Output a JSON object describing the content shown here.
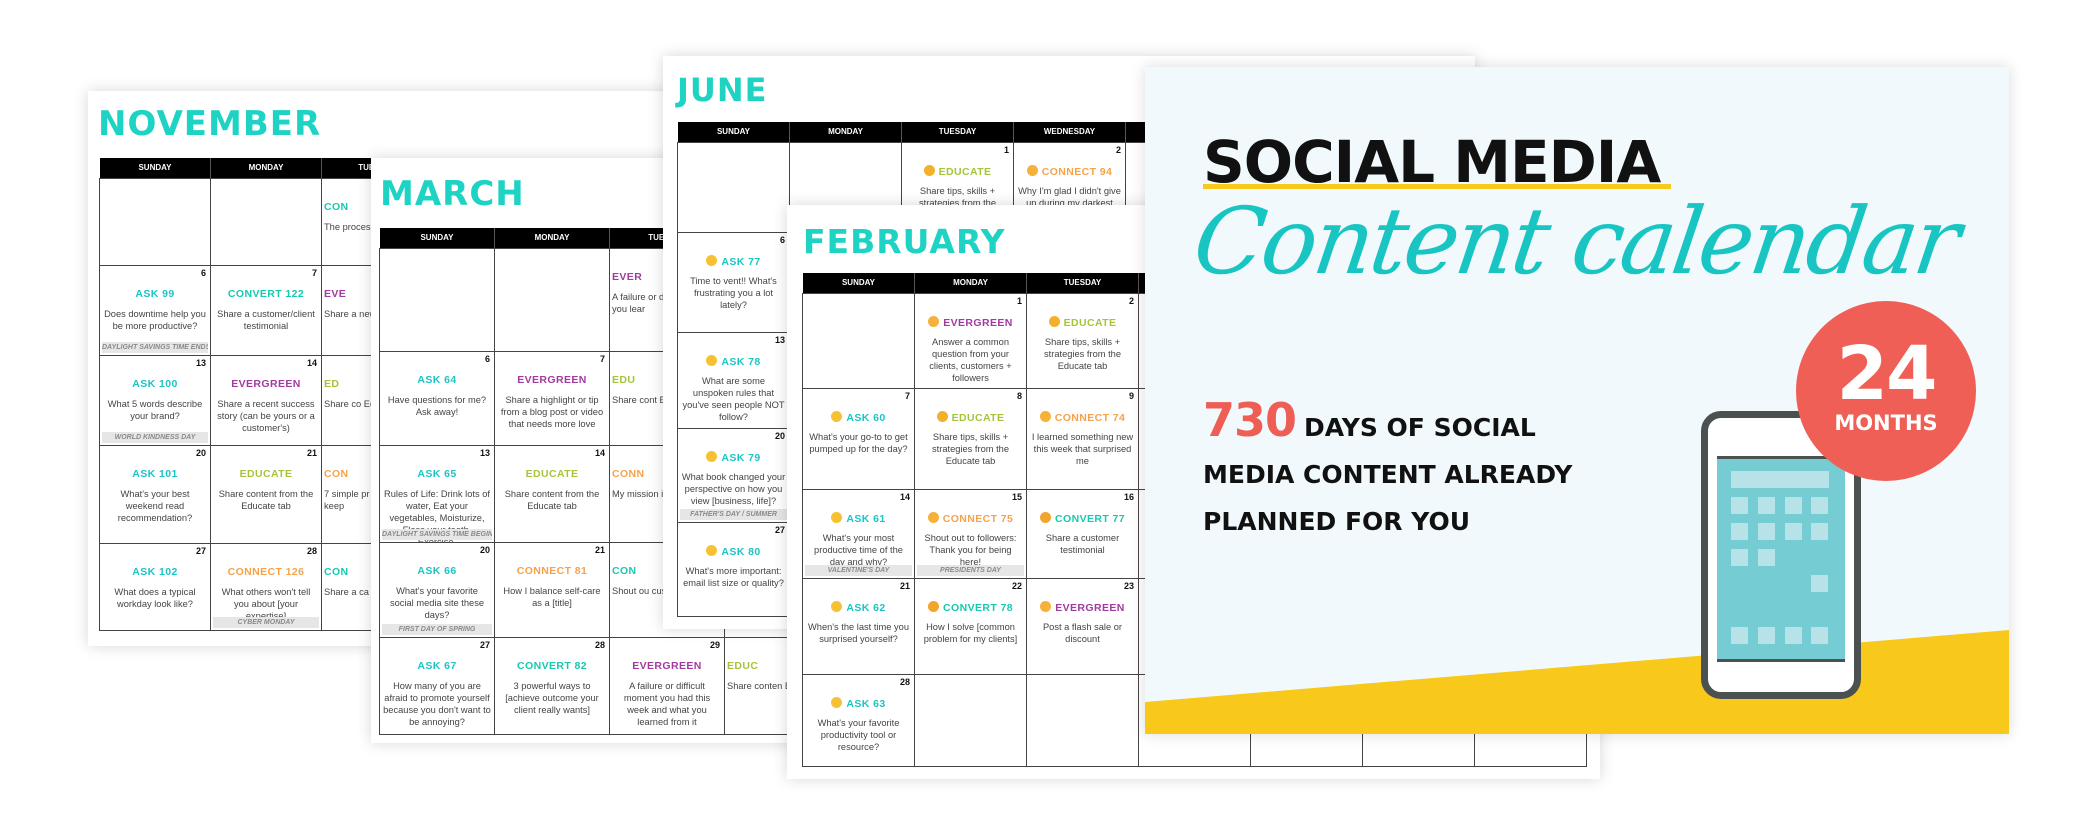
{
  "colors": {
    "month_title": "#1ed3c3",
    "ask": "#1cc4c6",
    "convert": "#17c9ae",
    "evergreen": "#a33a9f",
    "educate": "#a6c43a",
    "connect": "#f5a24b",
    "cover_accent_yellow": "#f8c91b",
    "cover_red": "#ef5f55",
    "cover_script_teal": "#19c5c2"
  },
  "icons": {
    "ask": "thinking-face-icon",
    "educate": "thumbs-up-icon",
    "connect": "waving-hand-icon",
    "convert": "handshake-icon",
    "evergreen": "hugging-face-icon"
  },
  "sheets": [
    {
      "month": "NOVEMBER",
      "emoji": false,
      "headers": [
        "SUNDAY",
        "MONDAY",
        "TUESDAY"
      ],
      "weeks": [
        [
          {},
          {},
          {
            "partial": true,
            "type": "convert",
            "label": "CON",
            "text": "The process out student"
          }
        ],
        [
          {
            "day": "6",
            "type": "ask",
            "label": "ASK 99",
            "text": "Does downtime help you be more productive?",
            "note": "DAYLIGHT SAVINGS TIME ENDS"
          },
          {
            "day": "7",
            "type": "convert",
            "label": "CONVERT 122",
            "text": "Share a customer/client testimonial"
          },
          {
            "partial": true,
            "type": "evergreen",
            "label": "EVE",
            "text": "Share a new or pod"
          }
        ],
        [
          {
            "day": "13",
            "type": "ask",
            "label": "ASK 100",
            "text": "What 5 words describe your brand?",
            "note": "WORLD KINDNESS DAY"
          },
          {
            "day": "14",
            "type": "evergreen",
            "label": "EVERGREEN",
            "text": "Share a recent success story (can be yours or a customer's)"
          },
          {
            "partial": true,
            "type": "educate",
            "label": "ED",
            "text": "Share co Edu"
          }
        ],
        [
          {
            "day": "20",
            "type": "ask",
            "label": "ASK 101",
            "text": "What's your best weekend read recommendation?"
          },
          {
            "day": "21",
            "type": "educate",
            "label": "EDUCATE",
            "text": "Share content from the Educate tab"
          },
          {
            "partial": true,
            "type": "connect",
            "label": "CON",
            "text": "7 simple pr do every d keep"
          }
        ],
        [
          {
            "day": "27",
            "type": "ask",
            "label": "ASK 102",
            "text": "What does a typical workday look like?"
          },
          {
            "day": "28",
            "type": "connect",
            "label": "CONNECT 126",
            "text": "What others won't tell you about [your expertise]",
            "note": "CYBER MONDAY"
          },
          {
            "partial": true,
            "type": "convert",
            "label": "CON",
            "text": "Share a ca yours"
          }
        ]
      ]
    },
    {
      "month": "MARCH",
      "emoji": false,
      "headers": [
        "SUNDAY",
        "MONDAY",
        "TUESDAY",
        ""
      ],
      "weeks": [
        [
          {},
          {},
          {
            "partial": true,
            "type": "evergreen",
            "label": "EVER",
            "text": "A failure or d you had this you lear"
          },
          {}
        ],
        [
          {
            "day": "6",
            "type": "ask",
            "label": "ASK 64",
            "text": "Have questions for me? Ask away!"
          },
          {
            "day": "7",
            "type": "evergreen",
            "label": "EVERGREEN",
            "text": "Share a highlight or tip from a blog post or video that needs more love"
          },
          {
            "partial": true,
            "type": "educate",
            "label": "EDU",
            "text": "Share cont Educ"
          },
          {}
        ],
        [
          {
            "day": "13",
            "type": "ask",
            "label": "ASK 65",
            "text": "Rules of Life: Drink lots of water, Eat your vegetables, Moisturize, Floss your teeth, Exercise.",
            "note": "DAYLIGHT SAVINGS TIME BEGINS"
          },
          {
            "day": "14",
            "type": "educate",
            "label": "EDUCATE",
            "text": "Share content from the Educate tab"
          },
          {
            "partial": true,
            "type": "connect",
            "label": "CONN",
            "text": "My mission it's so import"
          },
          {}
        ],
        [
          {
            "day": "20",
            "type": "ask",
            "label": "ASK 66",
            "text": "What's your favorite social media site these days?",
            "note": "FIRST DAY OF SPRING"
          },
          {
            "day": "21",
            "type": "connect",
            "label": "CONNECT 81",
            "text": "How I balance self-care as a [title]"
          },
          {
            "partial": true,
            "type": "convert",
            "label": "CON",
            "text": "Shout ou customer"
          },
          {}
        ],
        [
          {
            "day": "27",
            "type": "ask",
            "label": "ASK 67",
            "text": "How many of you are afraid to promote yourself because you don't want to be annoying?"
          },
          {
            "day": "28",
            "type": "convert",
            "label": "CONVERT 82",
            "text": "3 powerful ways to [achieve outcome your client really wants]"
          },
          {
            "day": "29",
            "type": "evergreen",
            "label": "EVERGREEN",
            "text": "A failure or difficult moment you had this week and what you learned from it"
          },
          {
            "partial": true,
            "type": "educate",
            "label": "EDUC",
            "text": "Share conten Educate"
          }
        ]
      ]
    },
    {
      "month": "JUNE",
      "emoji": true,
      "headers": [
        "SUNDAY",
        "MONDAY",
        "TUESDAY",
        "WEDNESDAY",
        ""
      ],
      "weeks": [
        [
          {},
          {},
          {
            "day": "1",
            "type": "educate",
            "label": "EDUCATE",
            "text": "Share tips, skills + strategies from the Educate tab"
          },
          {
            "day": "2",
            "type": "connect",
            "label": "CONNECT 94",
            "text": "Why I'm glad I didn't give up during my darkest time"
          },
          {}
        ],
        [
          {
            "day": "6",
            "type": "ask",
            "label": "ASK 77",
            "text": "Time to vent!! What's frustrating you a lot lately?"
          },
          {},
          {},
          {},
          {}
        ],
        [
          {
            "day": "13",
            "type": "ask",
            "label": "ASK 78",
            "text": "What are some unspoken rules that you've seen people NOT follow?"
          },
          {},
          {},
          {},
          {}
        ],
        [
          {
            "day": "20",
            "type": "ask",
            "label": "ASK 79",
            "text": "What book changed your perspective on how you view [business, life]?",
            "note": "FATHER'S DAY / SUMMER"
          },
          {},
          {},
          {},
          {}
        ],
        [
          {
            "day": "27",
            "type": "ask",
            "label": "ASK 80",
            "text": "What's more important: email list size or quality?"
          },
          {},
          {},
          {},
          {}
        ]
      ]
    },
    {
      "month": "FEBRUARY",
      "emoji": true,
      "headers": [
        "SUNDAY",
        "MONDAY",
        "TUESDAY",
        "",
        "",
        "",
        ""
      ],
      "weeks": [
        [
          {},
          {
            "day": "1",
            "type": "evergreen",
            "label": "EVERGREEN",
            "text": "Answer a common question from your clients, customers + followers"
          },
          {
            "day": "2",
            "type": "educate",
            "label": "EDUCATE",
            "text": "Share tips, skills + strategies from the Educate tab"
          },
          {},
          {},
          {},
          {}
        ],
        [
          {
            "day": "7",
            "type": "ask",
            "label": "ASK 60",
            "text": "What's your go-to to get pumped up for the day?"
          },
          {
            "day": "8",
            "type": "educate",
            "label": "EDUCATE",
            "text": "Share tips, skills + strategies from the Educate tab"
          },
          {
            "day": "9",
            "type": "connect",
            "label": "CONNECT 74",
            "text": "I learned something new this week that surprised me"
          },
          {},
          {},
          {},
          {}
        ],
        [
          {
            "day": "14",
            "type": "ask",
            "label": "ASK 61",
            "text": "What's your most productive time of the day and why?",
            "note": "VALENTINE'S DAY"
          },
          {
            "day": "15",
            "type": "connect",
            "label": "CONNECT 75",
            "text": "Shout out to followers: Thank you for being here!",
            "note": "PRESIDENTS DAY"
          },
          {
            "day": "16",
            "type": "convert",
            "label": "CONVERT 77",
            "text": "Share a customer testimonial"
          },
          {},
          {},
          {},
          {}
        ],
        [
          {
            "day": "21",
            "type": "ask",
            "label": "ASK 62",
            "text": "When's the last time you surprised yourself?"
          },
          {
            "day": "22",
            "type": "convert",
            "label": "CONVERT 78",
            "text": "How I solve [common problem for my clients]"
          },
          {
            "day": "23",
            "type": "evergreen",
            "label": "EVERGREEN",
            "text": "Post a flash sale or discount"
          },
          {},
          {},
          {},
          {}
        ],
        [
          {
            "day": "28",
            "type": "ask",
            "label": "ASK 63",
            "text": "What's your favorite productivity tool or resource?"
          },
          {},
          {},
          {},
          {},
          {},
          {}
        ]
      ]
    }
  ],
  "cover": {
    "title": "SOCIAL MEDIA",
    "script_title": "Content calendar",
    "highlight_number": "730",
    "tagline_lines": [
      "DAYS OF SOCIAL",
      "MEDIA CONTENT ALREADY",
      "PLANNED FOR YOU"
    ],
    "badge_number": "24",
    "badge_unit": "MONTHS",
    "illustration": "smartphone-calendar-icon"
  }
}
